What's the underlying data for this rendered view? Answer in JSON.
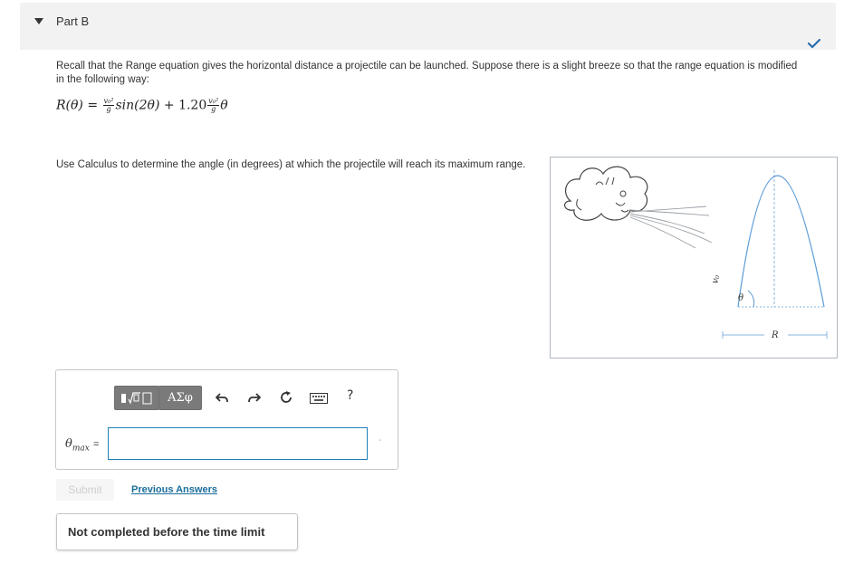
{
  "part": {
    "title": "Part B",
    "caret_icon": "caret-down-icon",
    "status_icon": "checkmark-icon",
    "check_color": "#2a6ead"
  },
  "intro": "Recall that the Range equation gives the horizontal distance a projectile can be launched. Suppose there is a slight breeze so that the range equation is modified in the following way:",
  "equation": {
    "lhs": "R(θ)",
    "eq": "=",
    "frac_num": "v₀²",
    "frac_den": "g",
    "sin_term": "sin(2θ)",
    "plus": "+",
    "coef": "1.20",
    "theta": "θ"
  },
  "question": "Use Calculus to determine the angle (in degrees) at which the projectile will reach its maximum range.",
  "figure": {
    "v0_label": "v₀",
    "theta_label": "θ",
    "range_label": "R"
  },
  "toolbar": {
    "templates_icon": "fraction-root-template-icon",
    "greek_label": "ΑΣφ",
    "undo_icon": "undo-icon",
    "redo_icon": "redo-icon",
    "reset_icon": "reset-icon",
    "keyboard_icon": "keyboard-icon",
    "help_label": "?"
  },
  "answer": {
    "variable": "θ",
    "subscript": "max",
    "equals": "=",
    "value": ""
  },
  "submit_label": "Submit",
  "previous_answers_label": "Previous Answers",
  "status_text": "Not completed before the time limit"
}
